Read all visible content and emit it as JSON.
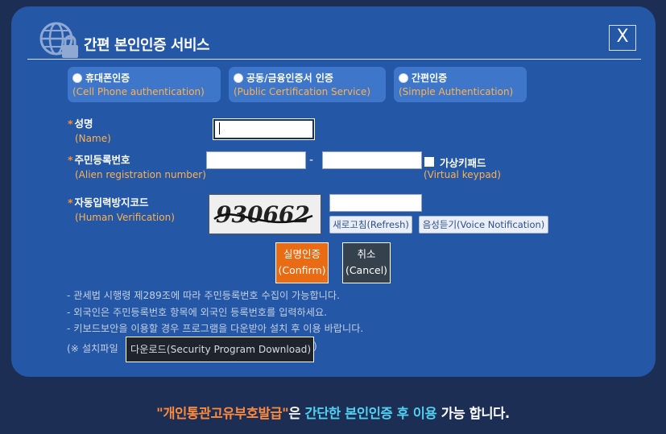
{
  "dialog": {
    "title": "간편 본인인증 서비스",
    "close_label": "X"
  },
  "tabs": [
    {
      "label": "휴대폰인증",
      "sublabel": "(Cell Phone authentication)"
    },
    {
      "label": "공동/금융인증서 인증",
      "sublabel": "(Public Certification Service)"
    },
    {
      "label": "간편인증",
      "sublabel": "(Simple Authentication)"
    }
  ],
  "form": {
    "required_mark": "*",
    "name_label": "성명",
    "name_sub": "(Name)",
    "name_value": "",
    "reg_label": "주민등록번호",
    "reg_sub": "(Alien registration number)",
    "reg_front_value": "",
    "reg_back_value": "",
    "reg_separator": "-",
    "keypad_label": "가상키패드",
    "keypad_sub": "(Virtual keypad)",
    "captcha_label": "자동입력방지코드",
    "captcha_sub": "(Human Verification)",
    "captcha_text": "930662",
    "captcha_value": "",
    "refresh_label": "새로고침(Refresh)",
    "voice_label": "음성듣기(Voice Notification)"
  },
  "buttons": {
    "confirm_line1": "실명인증",
    "confirm_line2": "(Confirm)",
    "cancel_line1": "취소",
    "cancel_line2": "(Cancel)"
  },
  "notes": [
    "- 관세법 시행령 제289조에 따라 주민등록번호 수집이 가능합니다.",
    "- 외국인은 주민등록번호 항목에 외국인 등록번호를 입력하세요.",
    "- 키보드보안을 이용할 경우 프로그램을 다운받아 설치 후 이용 바랍니다."
  ],
  "download": {
    "prefix": "(※ 설치파일",
    "button_label": "다운로드(Security Program Download)",
    "suffix": ")"
  },
  "footer": {
    "part1": "\"개인통관고유부호발급\"",
    "part2": "은 ",
    "part3": "간단한 본인인증 후 이용",
    "part4": " 가능 합니다."
  },
  "colors": {
    "dialog_bg": "#2457a6",
    "page_bg": "#1d2e55",
    "accent_orange": "#e96b13",
    "sublabel_orange": "#ffb14f",
    "footer_cyan": "#4fd0f0"
  }
}
